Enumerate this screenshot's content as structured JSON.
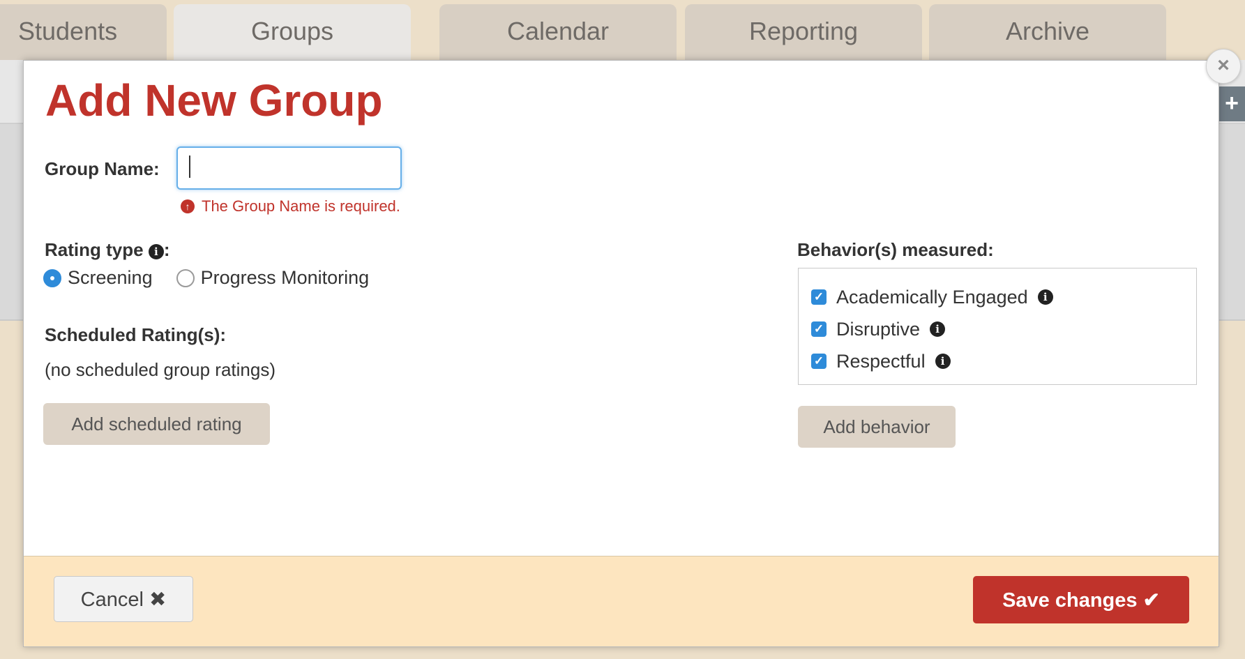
{
  "tabs": [
    {
      "label": "Students",
      "active": false
    },
    {
      "label": "Groups",
      "active": true
    },
    {
      "label": "Calendar",
      "active": false
    },
    {
      "label": "Reporting",
      "active": false
    },
    {
      "label": "Archive",
      "active": false
    }
  ],
  "side_button": {
    "label": "+"
  },
  "modal": {
    "close_label": "×",
    "title": "Add New Group",
    "group_name": {
      "label": "Group Name:",
      "value": "",
      "error": "The Group Name is required."
    },
    "rating_type": {
      "label": "Rating type",
      "suffix": ":",
      "options": [
        {
          "label": "Screening",
          "checked": true
        },
        {
          "label": "Progress Monitoring",
          "checked": false
        }
      ]
    },
    "scheduled_ratings": {
      "label": "Scheduled Rating(s):",
      "empty_text": "(no scheduled group ratings)",
      "add_button": "Add scheduled rating"
    },
    "behaviors": {
      "label": "Behavior(s) measured:",
      "items": [
        {
          "label": "Academically Engaged",
          "checked": true
        },
        {
          "label": "Disruptive",
          "checked": true
        },
        {
          "label": "Respectful",
          "checked": true
        }
      ],
      "add_button": "Add behavior"
    },
    "footer": {
      "cancel_label": "Cancel",
      "cancel_icon": "✖",
      "save_label": "Save changes",
      "save_icon": "✔"
    }
  },
  "colors": {
    "accent_red": "#c0332b",
    "focus_blue": "#66afe9",
    "checkbox_blue": "#2e8bd9",
    "footer_bg": "#fde5bf",
    "page_bg": "#ecdfc9"
  }
}
